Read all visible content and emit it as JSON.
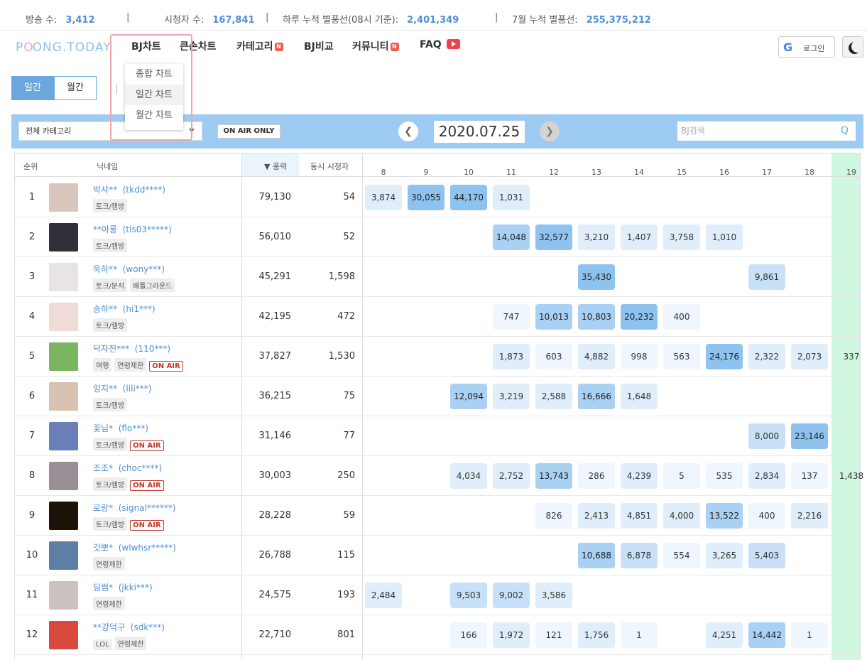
{
  "stats": [
    {
      "label": "방송 수:",
      "value": "3,412"
    },
    {
      "label": "시청자 수:",
      "value": "167,841"
    },
    {
      "label": "하루 누적 별풍선(08시 기준):",
      "value": "2,401,349"
    },
    {
      "label": "7월 누적 별풍선:",
      "value": "255,375,212"
    }
  ],
  "stats_separator": "|",
  "logo": {
    "part1": "P",
    "part2": "ONG.TODAY",
    "o": "O"
  },
  "menu": {
    "bj_chart": "BJ차트",
    "big_chart": "큰손차트",
    "category": "카테고리",
    "bj_compare": "BJ비교",
    "community": "커뮤니티",
    "faq": "FAQ",
    "new_badge": "N"
  },
  "login": {
    "g": "G",
    "label": "로그인"
  },
  "dropdown": [
    "종합 차트",
    "일간 차트",
    "월간 차트"
  ],
  "period": {
    "daily": "일간",
    "monthly": "월간"
  },
  "filter": {
    "category": "전체 카테고리",
    "on_air_only": "ON AIR ONLY",
    "prev": "❮",
    "next": "❯",
    "date": "2020.07.25",
    "search_placeholder": "BJ검색",
    "search_icon": "search-icon"
  },
  "headers": {
    "rank": "순위",
    "nickname": "닉네임",
    "power": "▼ 풍력",
    "viewers": "동시 시청자",
    "hours": [
      "8",
      "9",
      "10",
      "11",
      "12",
      "13",
      "14",
      "15",
      "16",
      "17",
      "18",
      "19"
    ]
  },
  "colors": {
    "accent": "#6ba7dd",
    "filter_bar": "#9ecbf2",
    "link": "#4d90d6",
    "on_air": "#c0392b",
    "hour19_bg": "#d0f7df"
  },
  "on_air_label": "ON AIR",
  "rows": [
    {
      "rank": "1",
      "nick": "박샤**",
      "id": "(tkdd****)",
      "tags": [
        "토크/캠방"
      ],
      "onair": false,
      "power": "79,130",
      "viewers": "54",
      "avatar": "#d9c7bd",
      "hours": {
        "8": "3,874",
        "9": "30,055",
        "10": "44,170",
        "11": "1,031"
      }
    },
    {
      "rank": "2",
      "nick": "**아롱",
      "id": "(tls03*****)",
      "tags": [
        "토크/캠방"
      ],
      "onair": false,
      "power": "56,010",
      "viewers": "52",
      "avatar": "#2f3038",
      "hours": {
        "11": "14,048",
        "12": "32,577",
        "13": "3,210",
        "14": "1,407",
        "15": "3,758",
        "16": "1,010"
      }
    },
    {
      "rank": "3",
      "nick": "욱하**",
      "id": "(wony***)",
      "tags": [
        "토크/분석",
        "배틀그라운드"
      ],
      "onair": false,
      "power": "45,291",
      "viewers": "1,598",
      "avatar": "#e8e4e2",
      "hours": {
        "13": "35,430",
        "17": "9,861"
      }
    },
    {
      "rank": "4",
      "nick": "송하**",
      "id": "(hi1***)",
      "tags": [
        "토크/캠방"
      ],
      "onair": false,
      "power": "42,195",
      "viewers": "472",
      "avatar": "#efdcd6",
      "hours": {
        "11": "747",
        "12": "10,013",
        "13": "10,803",
        "14": "20,232",
        "15": "400"
      }
    },
    {
      "rank": "5",
      "nick": "덕자전***",
      "id": "(110***)",
      "tags": [
        "여행",
        "연령제한"
      ],
      "onair": true,
      "power": "37,827",
      "viewers": "1,530",
      "avatar": "#7bb562",
      "hours": {
        "11": "1,873",
        "12": "603",
        "13": "4,882",
        "14": "998",
        "15": "563",
        "16": "24,176",
        "17": "2,322",
        "18": "2,073",
        "19": "337"
      }
    },
    {
      "rank": "6",
      "nick": "잉지**",
      "id": "(lili***)",
      "tags": [
        "토크/캠방"
      ],
      "onair": false,
      "power": "36,215",
      "viewers": "75",
      "avatar": "#d8c2b2",
      "hours": {
        "10": "12,094",
        "11": "3,219",
        "12": "2,588",
        "13": "16,666",
        "14": "1,648"
      }
    },
    {
      "rank": "7",
      "nick": "꽃님*",
      "id": "(flo***)",
      "tags": [
        "토크/캠방"
      ],
      "onair": true,
      "power": "31,146",
      "viewers": "77",
      "avatar": "#6a7fb8",
      "hours": {
        "17": "8,000",
        "18": "23,146"
      }
    },
    {
      "rank": "8",
      "nick": "조조*",
      "id": "(choc****)",
      "tags": [
        "토크/캠방"
      ],
      "onair": true,
      "power": "30,003",
      "viewers": "250",
      "avatar": "#9a8f96",
      "hours": {
        "10": "4,034",
        "11": "2,752",
        "12": "13,743",
        "13": "286",
        "14": "4,239",
        "15": "5",
        "16": "535",
        "17": "2,834",
        "18": "137",
        "19": "1,438"
      }
    },
    {
      "rank": "9",
      "nick": "로랑*",
      "id": "(signal******)",
      "tags": [
        "토크/캠방"
      ],
      "onair": true,
      "power": "28,228",
      "viewers": "59",
      "avatar": "#1b1208",
      "hours": {
        "12": "826",
        "13": "2,413",
        "14": "4,851",
        "15": "4,000",
        "16": "13,522",
        "17": "400",
        "18": "2,216"
      }
    },
    {
      "rank": "10",
      "nick": "갓뽀*",
      "id": "(wlwhsr*****)",
      "tags": [
        "연령제한"
      ],
      "onair": false,
      "power": "26,788",
      "viewers": "115",
      "avatar": "#5c7fa3",
      "hours": {
        "13": "10,688",
        "14": "6,878",
        "15": "554",
        "16": "3,265",
        "17": "5,403"
      }
    },
    {
      "rank": "11",
      "nick": "딤썸*",
      "id": "(jkki***)",
      "tags": [
        "연령제한"
      ],
      "onair": false,
      "power": "24,575",
      "viewers": "193",
      "avatar": "#ccc3c0",
      "hours": {
        "8": "2,484",
        "10": "9,503",
        "11": "9,002",
        "12": "3,586"
      }
    },
    {
      "rank": "12",
      "nick": "**강덕구",
      "id": "(sdk***)",
      "tags": [
        "LOL",
        "연령제한"
      ],
      "onair": false,
      "power": "22,710",
      "viewers": "801",
      "avatar": "#d9493e",
      "hours": {
        "10": "166",
        "11": "1,972",
        "12": "121",
        "13": "1,756",
        "14": "1",
        "16": "4,251",
        "17": "14,442",
        "18": "1"
      }
    }
  ]
}
